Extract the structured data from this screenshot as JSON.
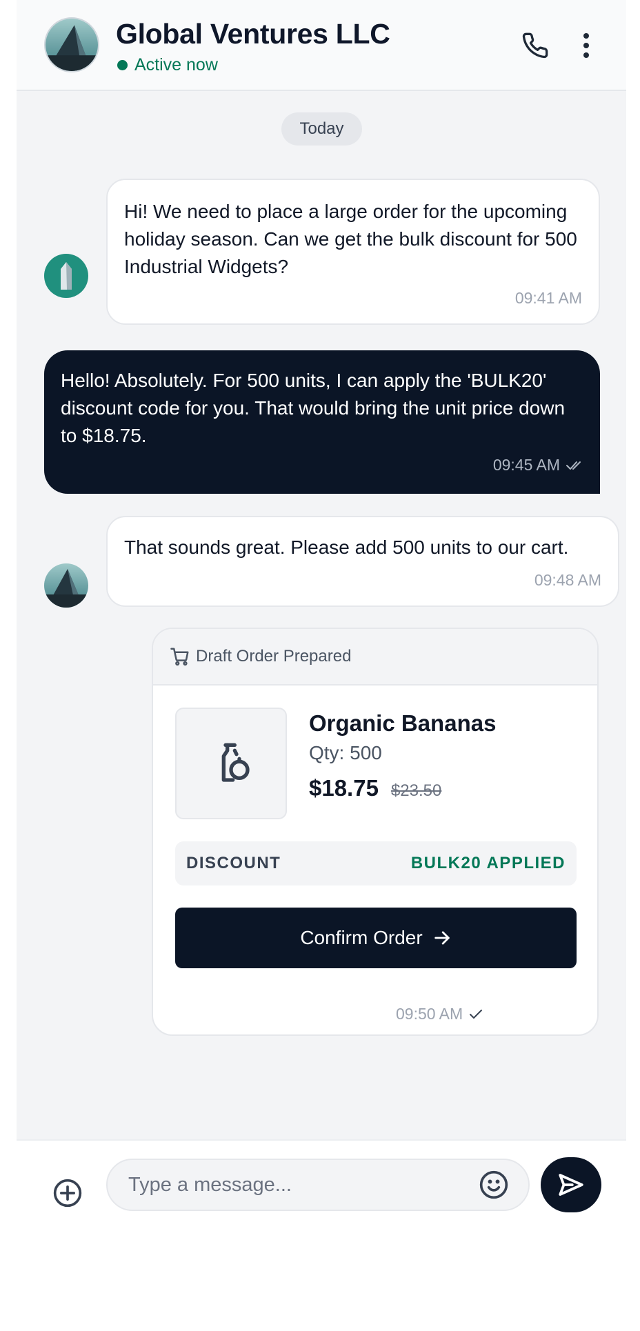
{
  "header": {
    "contact_name": "Global Ventures LLC",
    "status": "Active now",
    "status_color": "#047857",
    "avatar_icon": "building-icon",
    "call_icon": "phone-icon",
    "more_icon": "more-vertical-icon"
  },
  "date_divider": "Today",
  "messages": [
    {
      "direction": "incoming",
      "text": "Hi! We need to place a large order for the upcoming holiday season. Can we get the bulk discount for 500 Industrial Widgets?",
      "time": "09:41 AM"
    },
    {
      "direction": "outgoing",
      "text": "Hello! Absolutely. For 500 units, I can apply the 'BULK20' discount code for you. That would bring the unit price down to $18.75.",
      "time": "09:45 AM",
      "receipt_icon": "double-check-icon"
    },
    {
      "direction": "incoming",
      "text": "That sounds great. Please add 500 units to our cart.",
      "time": "09:48 AM"
    }
  ],
  "order_card": {
    "header_icon": "cart-icon",
    "header": "Draft Order Prepared",
    "product_icon": "bottle-icon",
    "product_name": "Organic Bananas",
    "qty": "Qty: 500",
    "price": "$18.75",
    "original_price": "$23.50",
    "discount_label": "DISCOUNT",
    "discount_value": "BULK20 APPLIED",
    "confirm_label": "Confirm Order",
    "confirm_icon": "arrow-right-icon",
    "time": "09:50 AM",
    "receipt_icon": "check-icon"
  },
  "composer": {
    "attach_icon": "plus-circle-icon",
    "placeholder": "Type a message...",
    "value": "",
    "emoji_icon": "smiley-icon",
    "send_icon": "send-icon"
  },
  "colors": {
    "dark": "#0b1526",
    "accent_green": "#047857",
    "background": "#f3f4f6"
  }
}
